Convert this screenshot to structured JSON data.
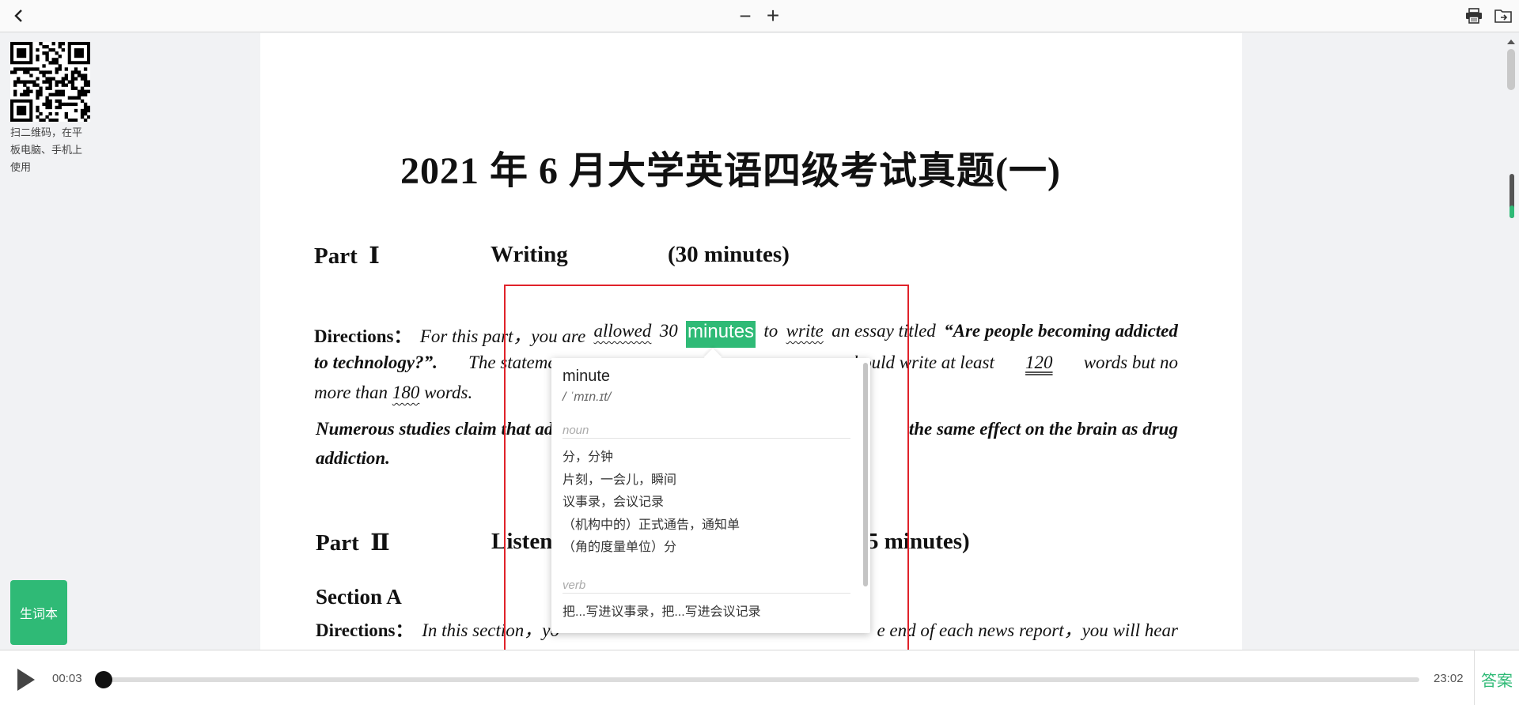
{
  "toolbar": {
    "back_icon": "chevron-left-icon",
    "zoom_out_label": "−",
    "zoom_in_label": "+",
    "print_icon": "printer-icon",
    "export_icon": "folder-export-icon"
  },
  "left_panel": {
    "qr_caption": "扫二维码，在平板电脑、手机上使用",
    "vocab_button": "生词本"
  },
  "document": {
    "title": "2021 年 6 月大学英语四级考试真题(一)",
    "part1": {
      "label": "Part",
      "numeral": "Ⅰ",
      "title": "Writing",
      "time": "(30 minutes)"
    },
    "part1_directions_label": "Directions：",
    "dir1_a": "For this part，you are",
    "dir1_allowed": "allowed",
    "dir1_b": "30",
    "dir1_minutes": "minutes",
    "dir1_to": "to",
    "dir1_write": "write",
    "dir1_c": "an essay titled",
    "dir1_title": "“Are people becoming addicted",
    "dir2_title": "to technology?”.",
    "dir2_a": "The statemen",
    "dir2_b": "u should write at least",
    "dir2_120": "120",
    "dir2_c": "words but no",
    "dir3_a": "more than",
    "dir3_180": "180",
    "dir3_b": "words.",
    "numerous_a": "Numerous studies claim that ad",
    "numerous_b": "the same effect on the brain as drug",
    "numerous_c": "addiction.",
    "part2": {
      "label": "Part",
      "numeral": "Ⅱ",
      "title": "Listen",
      "time": "5 minutes)"
    },
    "section_a": "Section A",
    "dirs_label": "Directions：",
    "dirs_a": "In this section，yo",
    "dirs_b": "e end of each news report，you will hear"
  },
  "dictionary": {
    "word": "minute",
    "phonetic": "/ ˈmɪn.ɪt/",
    "noun_label": "noun",
    "noun_defs": [
      "分，分钟",
      "片刻，一会儿，瞬间",
      "议事录，会议记录",
      "（机构中的）正式通告，通知单",
      "（角的度量单位）分"
    ],
    "verb_label": "verb",
    "verb_defs": [
      "把...写进议事录，把...写进会议记录"
    ]
  },
  "player": {
    "current_time": "00:03",
    "total_time": "23:02",
    "progress": 0.002,
    "answer_label": "答案"
  },
  "colors": {
    "accent": "#2fba76",
    "selection": "#e0222a"
  }
}
